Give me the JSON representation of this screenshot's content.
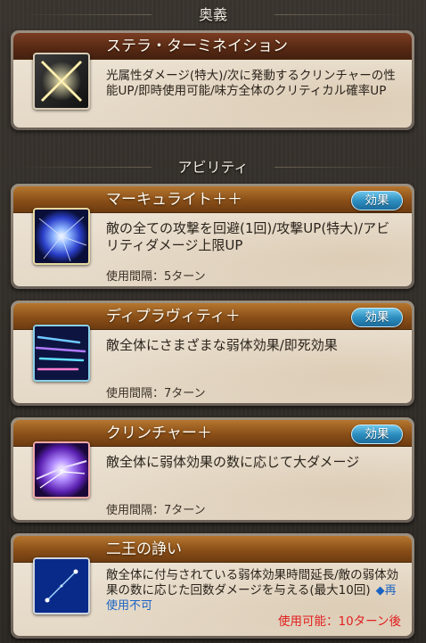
{
  "ougi": {
    "header": "奥義",
    "title": "ステラ・ターミネイション",
    "description": "光属性ダメージ(特大)/次に発動するクリンチャーの性能UP/即時使用可能/味方全体のクリティカル確率UP",
    "icon": "crossed-swords-icon"
  },
  "abilities": {
    "header": "アビリティ",
    "items": [
      {
        "title": "マーキュライト＋＋",
        "effect_label": "効果",
        "description": "敵の全ての攻撃を回避(1回)/攻撃UP(特大)/アビリティダメージ上限UP",
        "cooldown": "使用間隔：5ターン",
        "icon": "blue-burst-icon"
      },
      {
        "title": "ディプラヴィティ＋",
        "effect_label": "効果",
        "description": "敵全体にさまざまな弱体効果/即死効果",
        "cooldown": "使用間隔：7ターン",
        "icon": "arrows-icon"
      },
      {
        "title": "クリンチャー＋",
        "effect_label": "効果",
        "description": "敵全体に弱体効果の数に応じて大ダメージ",
        "cooldown": "使用間隔：7ターン",
        "icon": "purple-slash-icon"
      },
      {
        "title": "二王の諍い",
        "description": "敵全体に付与されている弱体効果時間延長/敵の弱体効果の数に応じた回数ダメージを与える(最大10回)",
        "unusable": "◆再使用不可",
        "available": "使用可能：10ターン後",
        "icon": "constellation-icon"
      }
    ]
  }
}
